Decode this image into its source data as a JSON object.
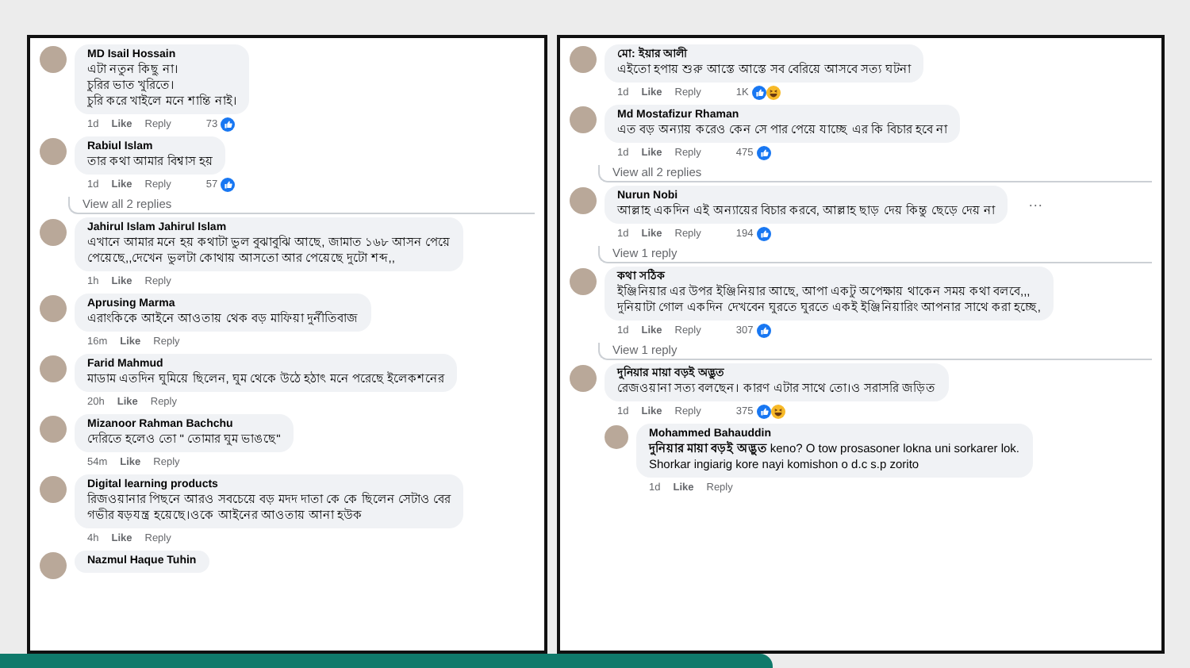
{
  "panels": [
    {
      "items": [
        {
          "kind": "comment",
          "name": "MD Isail Hossain",
          "lines": [
            "এটা নতুন কিছু না।",
            "চুরির ভাত খুরিতে।",
            "চুরি করে খাইলে মনে শান্তি নাই।"
          ],
          "time": "1d",
          "like": "Like",
          "reply": "Reply",
          "count": "73",
          "like_reaction": true
        },
        {
          "kind": "comment",
          "name": "Rabiul Islam",
          "lines": [
            "তার কথা আমার বিশ্বাস হয়"
          ],
          "time": "1d",
          "like": "Like",
          "reply": "Reply",
          "count": "57",
          "like_reaction": true
        },
        {
          "kind": "view_replies",
          "label": "View all 2 replies"
        },
        {
          "kind": "comment",
          "name": "Jahirul Islam Jahirul Islam",
          "lines": [
            "এখানে আমার মনে হয় কথাটা ভুল বুঝাবুঝি আছে, জামাত ১৬৮ আসন পেয়ে",
            "পেয়েছে,,দেখেন ভুলটা কোথায় আসতো আর পেয়েছে দুটো শব্দ,,"
          ],
          "time": "1h",
          "like": "Like",
          "reply": "Reply"
        },
        {
          "kind": "comment",
          "name": "Aprusing Marma",
          "lines": [
            "এরাংকিকে আইনে আওতায় থেক বড় মাফিয়া দুর্নীতিবাজ"
          ],
          "time": "16m",
          "like": "Like",
          "reply": "Reply"
        },
        {
          "kind": "comment",
          "name": "Farid Mahmud",
          "lines": [
            "মাডাম এতদিন ঘুমিয়ে ছিলেন, ঘুম থেকে উঠে হঠাৎ মনে পরেছে ইলেকশনের"
          ],
          "time": "20h",
          "like": "Like",
          "reply": "Reply"
        },
        {
          "kind": "comment",
          "name": "Mizanoor Rahman Bachchu",
          "lines": [
            "দেরিতে হলেও তো \" তোমার ঘুম ভাঙছে\""
          ],
          "time": "54m",
          "like": "Like",
          "reply": "Reply"
        },
        {
          "kind": "comment",
          "name": "Digital learning products",
          "lines": [
            "রিজওয়ানার পিছনে আরও সবচেয়ে বড় মদদ দাতা কে কে ছিলেন সেটাও বের",
            "গভীর ষড়যন্ত্র হয়েছে।ওকে আইনের আওতায় আনা হউক"
          ],
          "time": "4h",
          "like": "Like",
          "reply": "Reply"
        },
        {
          "kind": "comment",
          "name": "Nazmul Haque Tuhin"
        }
      ]
    },
    {
      "items": [
        {
          "kind": "comment",
          "name": "মো: ইয়ার আলী",
          "lines": [
            "এইতো হপায় শুরু আস্তে আস্তে সব বেরিয়ে আসবে সত্য ঘটনা"
          ],
          "time": "1d",
          "like": "Like",
          "reply": "Reply",
          "count": "1K",
          "like_reaction": true,
          "haha_reaction": true
        },
        {
          "kind": "comment",
          "name": "Md Mostafizur Rhaman",
          "lines": [
            "এত বড় অন্যায় করেও কেন সে পার পেয়ে যাচ্ছে এর কি বিচার হবে না"
          ],
          "time": "1d",
          "like": "Like",
          "reply": "Reply",
          "count": "475",
          "like_reaction": true
        },
        {
          "kind": "view_replies",
          "label": "View all 2 replies"
        },
        {
          "kind": "comment",
          "name": "Nurun Nobi",
          "lines": [
            "আল্লাহ একদিন এই অন্যায়ের বিচার করবে, আল্লাহ ছাড় দেয় কিন্তু ছেড়ে দেয় না"
          ],
          "time": "1d",
          "like": "Like",
          "reply": "Reply",
          "count": "194",
          "like_reaction": true,
          "more_menu": "···"
        },
        {
          "kind": "view_replies",
          "label": "View 1 reply"
        },
        {
          "kind": "comment",
          "name": "কথা সঠিক",
          "lines": [
            "ইঞ্জিনিয়ার এর উপর ইঞ্জিনিয়ার আছে, আপা একটু অপেক্ষায় থাকেন সময় কথা বলবে,,,",
            "দুনিয়াটা গোল একদিন দেখবেন ঘুরতে ঘুরতে একই ইঞ্জিনিয়ারিং আপনার সাথে করা হচ্ছে,"
          ],
          "time": "1d",
          "like": "Like",
          "reply": "Reply",
          "count": "307",
          "like_reaction": true
        },
        {
          "kind": "view_replies",
          "label": "View 1 reply"
        },
        {
          "kind": "comment",
          "name": "দুনিয়ার মায়া বড়ই অদ্ভুত",
          "lines": [
            "রেজওয়ানা সত্য বলছেন। কারণ এটার সাথে তো।ও সরাসরি জড়িত"
          ],
          "time": "1d",
          "like": "Like",
          "reply": "Reply",
          "count": "375",
          "like_reaction": true,
          "haha_reaction": true
        },
        {
          "kind": "reply",
          "name": "Mohammed Bahauddin",
          "lines": [
            "**দুনিয়ার মায়া বড়ই অদ্ভুত** keno? O tow prosasoner lokna uni sorkarer lok.",
            "Shorkar ingiarig kore nayi komishon o d.c s.p zorito"
          ],
          "time": "1d",
          "like": "Like",
          "reply": "Reply"
        }
      ]
    }
  ]
}
